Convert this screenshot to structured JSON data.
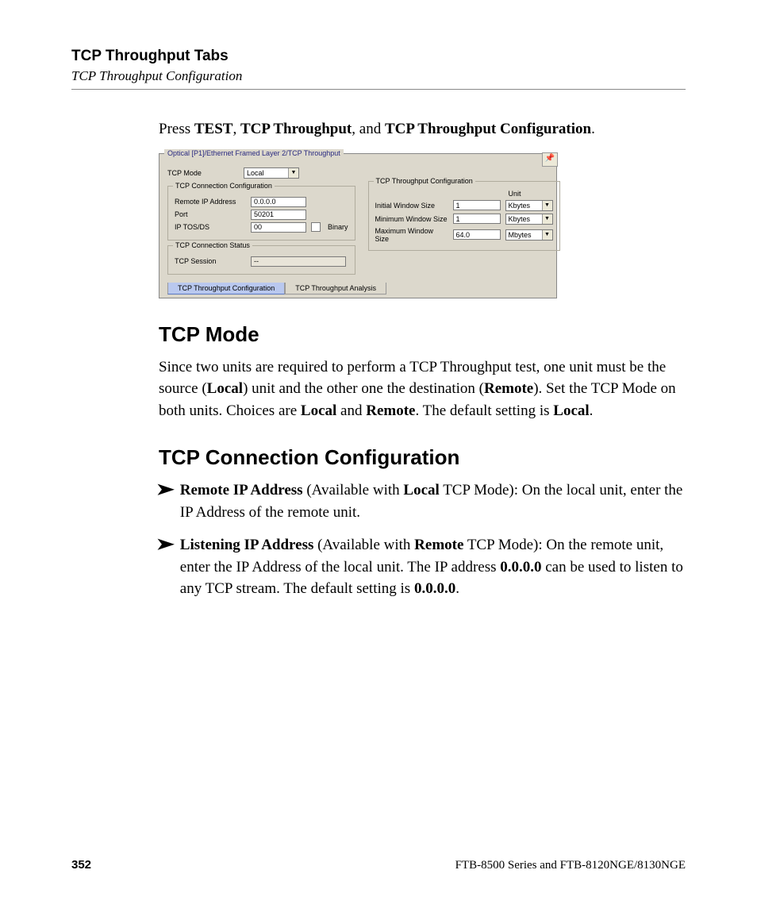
{
  "header": {
    "title": "TCP Throughput Tabs",
    "subtitle": "TCP Throughput Configuration"
  },
  "intro": {
    "pre": "Press ",
    "b1": "TEST",
    "sep1": ", ",
    "b2": "TCP Throughput",
    "sep2": ", and ",
    "b3": "TCP Throughput Configuration",
    "post": "."
  },
  "panel": {
    "title": "Optical [P1]/Ethernet Framed Layer 2/TCP Throughput",
    "tcpModeLabel": "TCP Mode",
    "tcpModeValue": "Local",
    "connCfgTitle": "TCP Connection Configuration",
    "remoteIpLabel": "Remote IP Address",
    "remoteIpValue": "0.0.0.0",
    "portLabel": "Port",
    "portValue": "50201",
    "tosLabel": "IP TOS/DS",
    "tosValue": "00",
    "binaryLabel": "Binary",
    "statusTitle": "TCP Connection Status",
    "sessionLabel": "TCP Session",
    "sessionValue": "--",
    "thruCfgTitle": "TCP Throughput Configuration",
    "unitLabel": "Unit",
    "initWinLabel": "Initial Window Size",
    "initWinValue": "1",
    "initWinUnit": "Kbytes",
    "minWinLabel": "Minimum Window Size",
    "minWinValue": "1",
    "minWinUnit": "Kbytes",
    "maxWinLabel": "Maximum Window Size",
    "maxWinValue": "64.0",
    "maxWinUnit": "Mbytes",
    "tab1": "TCP Throughput Configuration",
    "tab2": "TCP Throughput Analysis"
  },
  "section1": {
    "heading": "TCP Mode",
    "p_a": "Since two units are required to perform a TCP Throughput test, one unit must be the source (",
    "p_b": "Local",
    "p_c": ") unit and the other one the destination (",
    "p_d": "Remote",
    "p_e": "). Set the TCP Mode on both units. Choices are ",
    "p_f": "Local",
    "p_g": " and ",
    "p_h": "Remote",
    "p_i": ". The default setting is ",
    "p_j": "Local",
    "p_k": "."
  },
  "section2": {
    "heading": "TCP Connection Configuration",
    "bullet1": {
      "b1": "Remote IP Address",
      "t1": " (Available with ",
      "b2": "Local",
      "t2": " TCP Mode): On the local unit, enter the IP Address of the remote unit."
    },
    "bullet2": {
      "b1": "Listening IP Address",
      "t1": " (Available with ",
      "b2": "Remote",
      "t2": " TCP Mode): On the remote unit, enter the IP Address of the local unit. The IP address ",
      "b3": "0.0.0.0",
      "t3": " can be used to listen to any TCP stream. The default setting is ",
      "b4": "0.0.0.0",
      "t4": "."
    }
  },
  "footer": {
    "page": "352",
    "product": "FTB-8500 Series and FTB-8120NGE/8130NGE"
  }
}
